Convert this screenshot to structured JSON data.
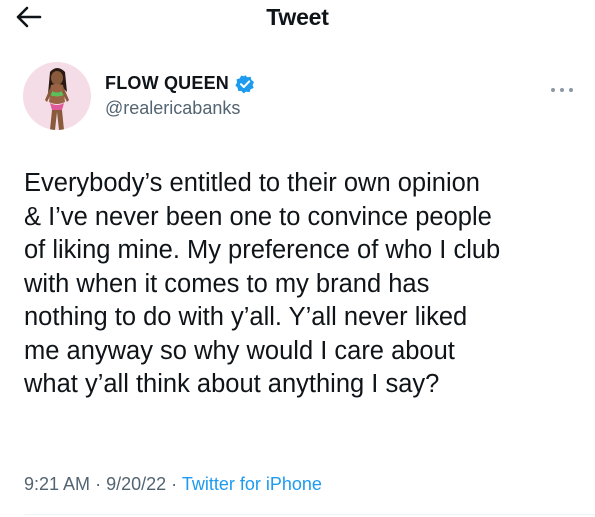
{
  "header": {
    "title": "Tweet",
    "back_icon": "arrow-left-icon"
  },
  "author": {
    "display_name": "FLOW QUEEN",
    "handle": "@realericabanks",
    "verified": true,
    "verified_color": "#1d9bf0"
  },
  "tweet": {
    "lines": [
      "Everybody’s entitled to their own opinion",
      "& I’ve never been one to convince people",
      "of liking mine. My preference of who I club",
      "with when it comes to my brand has",
      "nothing to do with y’all. Y’all never liked",
      "me anyway so why would I care about",
      "what y’all think about anything I say?"
    ]
  },
  "meta": {
    "time": "9:21 AM",
    "separator": "·",
    "date": "9/20/22",
    "source": "Twitter for iPhone",
    "source_color": "#1d9bf0"
  }
}
